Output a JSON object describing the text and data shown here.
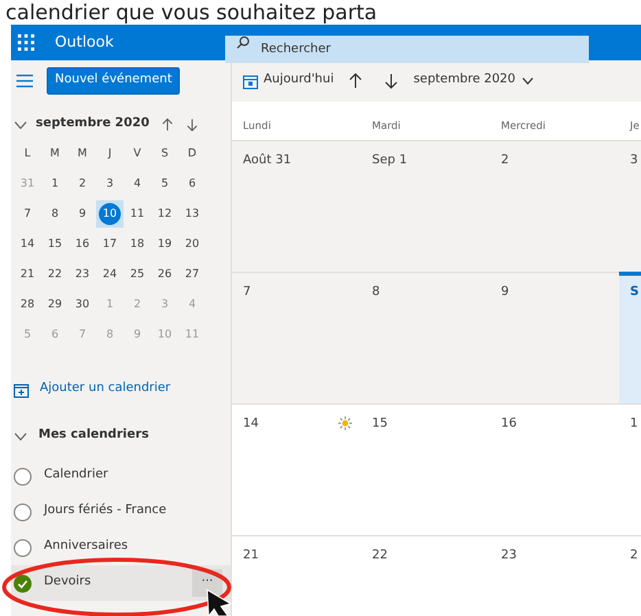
{
  "caption": "calendrier que vous souhaitez parta",
  "app_bar": {
    "app_name": "Outlook",
    "search": {
      "placeholder": "Rechercher"
    }
  },
  "new_event_button": "Nouvel événement",
  "toolbar": {
    "today_button": "Aujourd'hui",
    "month_picker": "septembre 2020"
  },
  "mini_calendar": {
    "title": "septembre 2020",
    "expanded": true,
    "weekdays": [
      "L",
      "M",
      "M",
      "J",
      "V",
      "S",
      "D"
    ],
    "weeks": [
      [
        {
          "day": "31",
          "in_month": false,
          "selected": false
        },
        {
          "day": "1",
          "in_month": true,
          "selected": false
        },
        {
          "day": "2",
          "in_month": true,
          "selected": false
        },
        {
          "day": "3",
          "in_month": true,
          "selected": false
        },
        {
          "day": "4",
          "in_month": true,
          "selected": false
        },
        {
          "day": "5",
          "in_month": true,
          "selected": false
        },
        {
          "day": "6",
          "in_month": true,
          "selected": false
        }
      ],
      [
        {
          "day": "7",
          "in_month": true,
          "selected": false
        },
        {
          "day": "8",
          "in_month": true,
          "selected": false
        },
        {
          "day": "9",
          "in_month": true,
          "selected": false
        },
        {
          "day": "10",
          "in_month": true,
          "selected": true
        },
        {
          "day": "11",
          "in_month": true,
          "selected": false
        },
        {
          "day": "12",
          "in_month": true,
          "selected": false
        },
        {
          "day": "13",
          "in_month": true,
          "selected": false
        }
      ],
      [
        {
          "day": "14",
          "in_month": true,
          "selected": false
        },
        {
          "day": "15",
          "in_month": true,
          "selected": false
        },
        {
          "day": "16",
          "in_month": true,
          "selected": false
        },
        {
          "day": "17",
          "in_month": true,
          "selected": false
        },
        {
          "day": "18",
          "in_month": true,
          "selected": false
        },
        {
          "day": "19",
          "in_month": true,
          "selected": false
        },
        {
          "day": "20",
          "in_month": true,
          "selected": false
        }
      ],
      [
        {
          "day": "21",
          "in_month": true,
          "selected": false
        },
        {
          "day": "22",
          "in_month": true,
          "selected": false
        },
        {
          "day": "23",
          "in_month": true,
          "selected": false
        },
        {
          "day": "24",
          "in_month": true,
          "selected": false
        },
        {
          "day": "25",
          "in_month": true,
          "selected": false
        },
        {
          "day": "26",
          "in_month": true,
          "selected": false
        },
        {
          "day": "27",
          "in_month": true,
          "selected": false
        }
      ],
      [
        {
          "day": "28",
          "in_month": true,
          "selected": false
        },
        {
          "day": "29",
          "in_month": true,
          "selected": false
        },
        {
          "day": "30",
          "in_month": true,
          "selected": false
        },
        {
          "day": "1",
          "in_month": false,
          "selected": false
        },
        {
          "day": "2",
          "in_month": false,
          "selected": false
        },
        {
          "day": "3",
          "in_month": false,
          "selected": false
        },
        {
          "day": "4",
          "in_month": false,
          "selected": false
        }
      ],
      [
        {
          "day": "5",
          "in_month": false,
          "selected": false
        },
        {
          "day": "6",
          "in_month": false,
          "selected": false
        },
        {
          "day": "7",
          "in_month": false,
          "selected": false
        },
        {
          "day": "8",
          "in_month": false,
          "selected": false
        },
        {
          "day": "9",
          "in_month": false,
          "selected": false
        },
        {
          "day": "10",
          "in_month": false,
          "selected": false
        },
        {
          "day": "11",
          "in_month": false,
          "selected": false
        }
      ]
    ]
  },
  "add_calendar_link": "Ajouter un calendrier",
  "my_calendars": {
    "title": "Mes calendriers",
    "expanded": true,
    "items": [
      {
        "label": "Calendrier",
        "checked": false
      },
      {
        "label": "Jours fériés - France",
        "checked": false
      },
      {
        "label": "Anniversaires",
        "checked": false
      },
      {
        "label": "Devoirs",
        "checked": true,
        "more_button": "···"
      }
    ]
  },
  "month_grid": {
    "columns": [
      "Lundi",
      "Mardi",
      "Mercredi",
      "Je"
    ],
    "weeks": [
      {
        "shaded": true,
        "days": [
          {
            "kind": "plain",
            "label": "Août 31",
            "today": false
          },
          {
            "kind": "plain",
            "label": "Sep 1",
            "today": false
          },
          {
            "kind": "plain",
            "label": "2",
            "today": false
          },
          {
            "kind": "plain",
            "label": "3",
            "today": false
          }
        ]
      },
      {
        "shaded": true,
        "days": [
          {
            "kind": "plain",
            "label": "7",
            "today": false
          },
          {
            "kind": "plain",
            "label": "8",
            "today": false
          },
          {
            "kind": "plain",
            "label": "9",
            "today": false
          },
          {
            "kind": "plain",
            "label": "S",
            "today": true
          }
        ]
      },
      {
        "shaded": false,
        "days": [
          {
            "kind": "sun",
            "label": "14",
            "today": false
          },
          {
            "kind": "plain",
            "label": "15",
            "today": false
          },
          {
            "kind": "plain",
            "label": "16",
            "today": false
          },
          {
            "kind": "plain",
            "label": "1",
            "today": false
          }
        ]
      },
      {
        "shaded": false,
        "days": [
          {
            "kind": "plain",
            "label": "21",
            "today": false
          },
          {
            "kind": "plain",
            "label": "22",
            "today": false
          },
          {
            "kind": "plain",
            "label": "23",
            "today": false
          },
          {
            "kind": "plain",
            "label": "2",
            "today": false
          }
        ]
      }
    ]
  },
  "annotations": [
    {
      "kind": "ellipse"
    },
    {
      "kind": "cursor"
    }
  ]
}
